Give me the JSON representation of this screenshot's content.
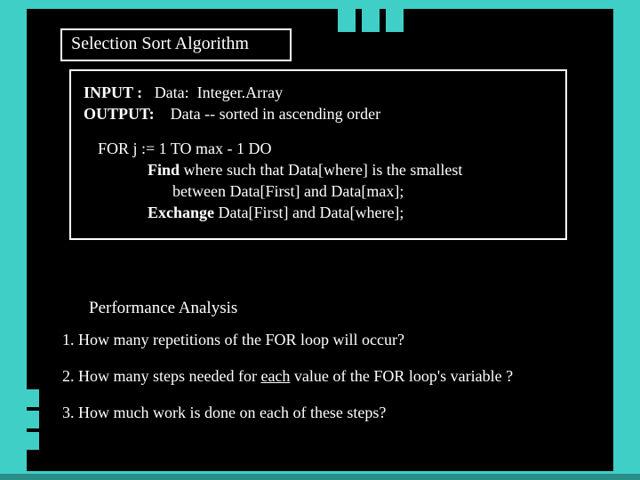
{
  "title": "Selection Sort Algorithm",
  "io": {
    "input_label": "INPUT :",
    "input_value": "   Data:  Integer.Array",
    "output_label": "OUTPUT:",
    "output_value": "    Data -- sorted in ascending order"
  },
  "algo": {
    "line1_a": "FOR j := 1 TO  max - 1  DO",
    "line2_kw": "Find",
    "line2_rest": " where such that  Data[where] is the smallest",
    "line3": "between Data[First] and Data[max];",
    "line4_kw": "Exchange",
    "line4_rest": " Data[First] and Data[where];"
  },
  "analysis": {
    "heading": "Performance Analysis",
    "q1": "1. How many repetitions of the FOR loop will occur?",
    "q2_a": "2. How many steps needed for ",
    "q2_u": "each",
    "q2_b": " value of the FOR loop's variable ?",
    "q3": "3. How much work is done on each of these steps?"
  }
}
